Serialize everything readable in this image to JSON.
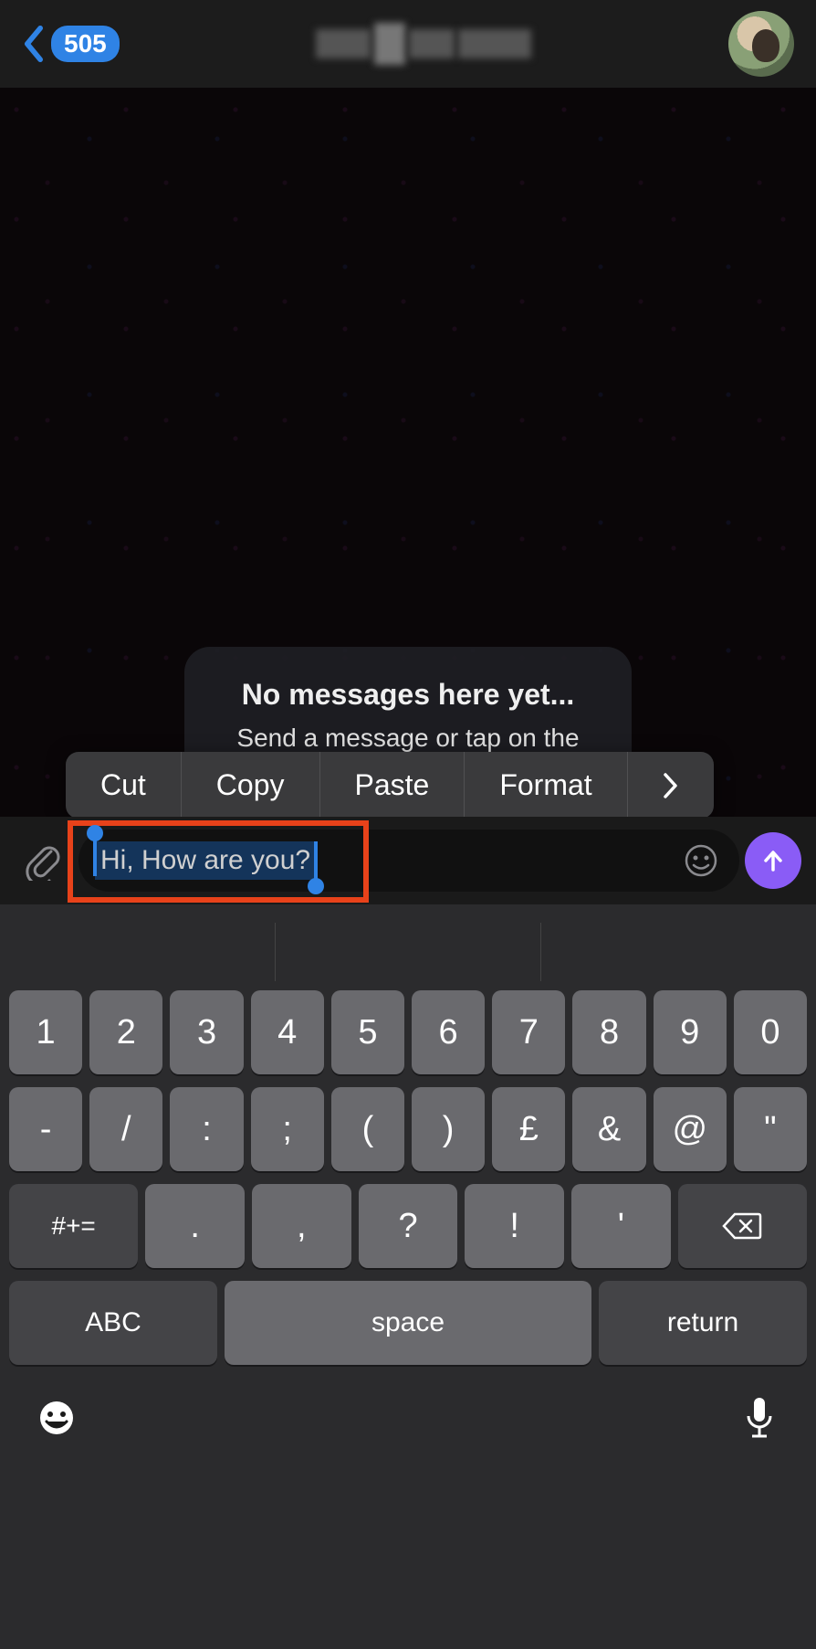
{
  "header": {
    "back_badge": "505"
  },
  "greeting": {
    "title": "No messages here yet...",
    "subtitle": "Send a message or tap on the greeting below."
  },
  "context_menu": {
    "cut": "Cut",
    "copy": "Copy",
    "paste": "Paste",
    "format": "Format"
  },
  "input": {
    "message_text": "Hi, How are you?"
  },
  "keyboard": {
    "row1": [
      "1",
      "2",
      "3",
      "4",
      "5",
      "6",
      "7",
      "8",
      "9",
      "0"
    ],
    "row2": [
      "-",
      "/",
      ":",
      ";",
      "(",
      ")",
      "£",
      "&",
      "@",
      "\""
    ],
    "row3": {
      "switch1": "#+=",
      "keys": [
        ".",
        ",",
        "?",
        "!",
        "'"
      ],
      "backspace_icon": "backspace"
    },
    "row4": {
      "abc": "ABC",
      "space": "space",
      "return": "return"
    }
  }
}
